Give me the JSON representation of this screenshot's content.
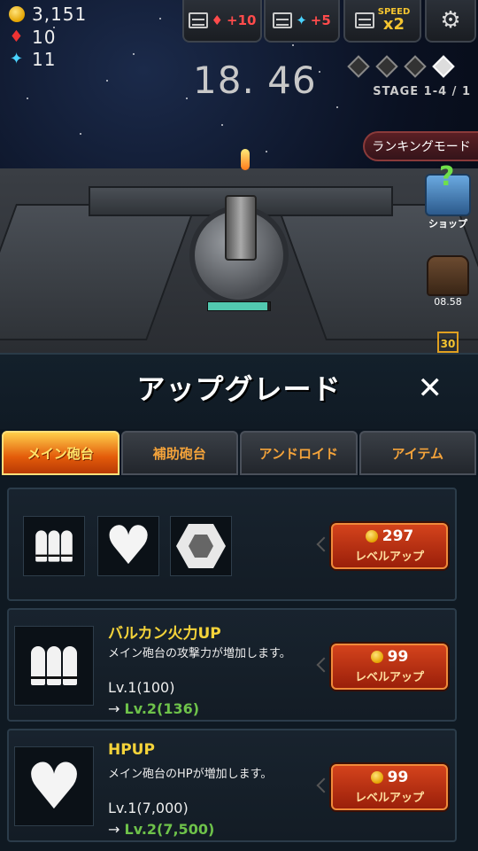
{
  "resources": {
    "coins": "3,151",
    "fire": "10",
    "gems": "11"
  },
  "top_buttons": {
    "ad_fire": "+10",
    "ad_gem": "+5",
    "speed_label": "SPEED",
    "speed_value": "x2"
  },
  "timer": "18. 46",
  "stage": "STAGE 1-4 / 1",
  "stage_progress": {
    "cleared": 1,
    "total": 4
  },
  "ranking_mode": "ランキングモード",
  "shop_label": "ショップ",
  "chest_timer": "08.58",
  "day_badge": "30",
  "turret_hp_ratio": 0.95,
  "panel": {
    "title": "アップグレード",
    "close": "✕"
  },
  "tabs": [
    {
      "label": "メイン砲台",
      "active": true
    },
    {
      "label": "補助砲台",
      "active": false
    },
    {
      "label": "アンドロイド",
      "active": false
    },
    {
      "label": "アイテム",
      "active": false
    }
  ],
  "summary": {
    "cost": "297",
    "button": "レベルアップ"
  },
  "upgrades": [
    {
      "name": "バルカン火力UP",
      "desc": "メイン砲台の攻撃力が増加します。",
      "level": "Lv.1(100)",
      "arrow": "→",
      "next": "Lv.2(136)",
      "cost": "99",
      "button": "レベルアップ"
    },
    {
      "name": "HPUP",
      "desc": "メイン砲台のHPが増加します。",
      "level": "Lv.1(7,000)",
      "arrow": "→",
      "next": "Lv.2(7,500)",
      "cost": "99",
      "button": "レベルアップ"
    }
  ],
  "colors": {
    "accent": "#f4d33a",
    "next_level": "#6ec24a",
    "button": "#c6381a"
  }
}
